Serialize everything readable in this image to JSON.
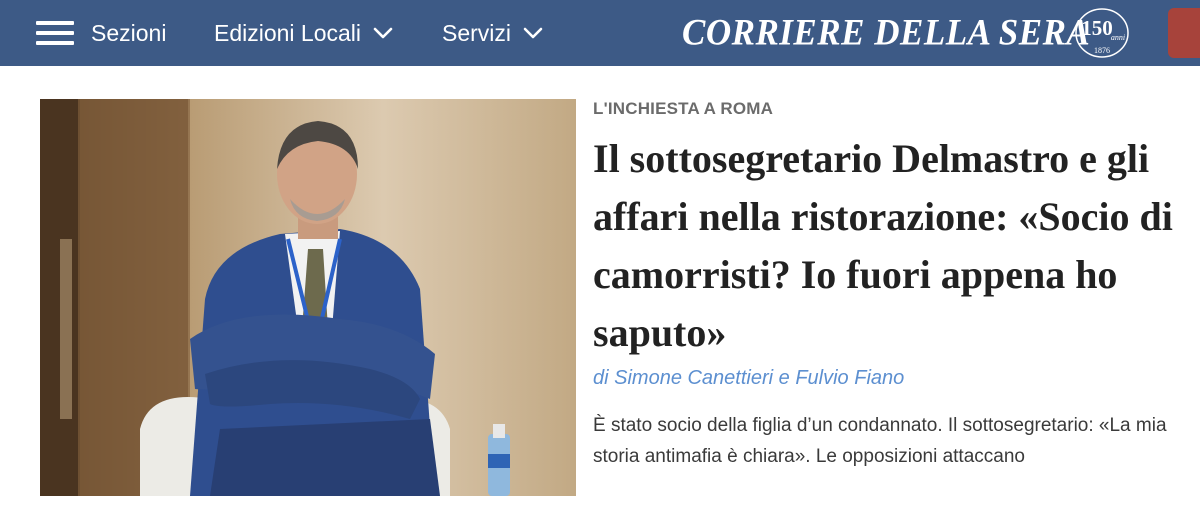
{
  "header": {
    "menu_label": "Sezioni",
    "nav": [
      {
        "label": "Edizioni Locali"
      },
      {
        "label": "Servizi"
      }
    ],
    "logo_text": "CORRIERE DELLA SERA",
    "anniversary": {
      "number": "150",
      "word": "anni",
      "year": "1876"
    },
    "bar_color": "#3d5a86",
    "button_color": "#a7433b"
  },
  "article": {
    "kicker": "L'INCHIESTA A ROMA",
    "headline": "Il sottosegretario Delmastro e gli affari nella ristorazione: «Socio di camorristi? Io fuori appena ho saputo»",
    "byline": "di Simone Canettieri e Fulvio Fiano",
    "summary": "È stato socio della figlia d’un condannato. Il sottosegretario: «La mia storia antimafia è chiara». Le opposizioni attaccano",
    "byline_color": "#5c8fd0"
  }
}
